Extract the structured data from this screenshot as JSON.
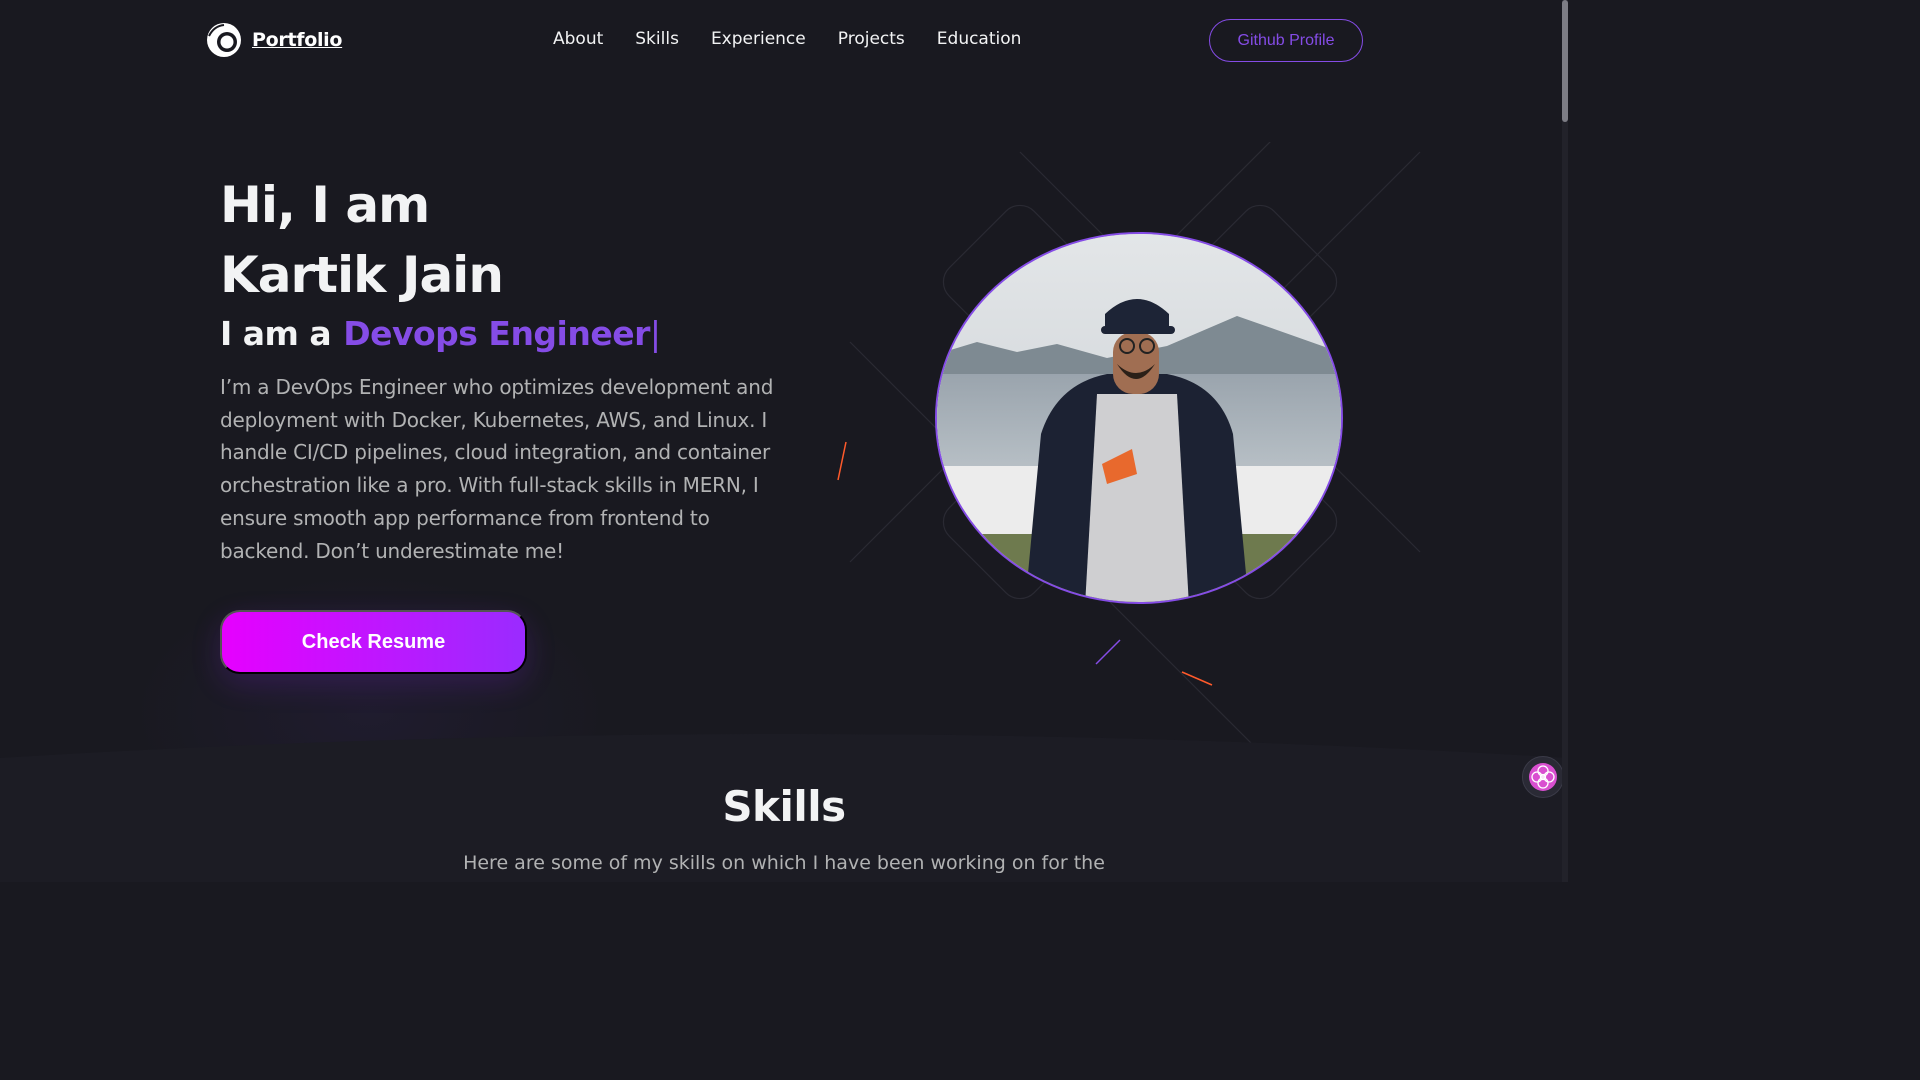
{
  "nav": {
    "logo_text": "Portfolio",
    "links": [
      "About",
      "Skills",
      "Experience",
      "Projects",
      "Education"
    ],
    "github_label": "Github Profile"
  },
  "hero": {
    "greeting_line1": "Hi, I am",
    "greeting_line2": "Kartik Jain",
    "subtitle_prefix": "I am a",
    "role": "Devops Engineer",
    "cursor": "|",
    "description": "I’m a DevOps Engineer who optimizes development and deployment with Docker, Kubernetes, AWS, and Linux. I handle CI/CD pipelines, cloud integration, and container orchestration like a pro. With full-stack skills in MERN, I ensure smooth app performance from frontend to backend. Don’t underestimate me!",
    "resume_button": "Check Resume",
    "photo_icon": "profile-photo"
  },
  "skills": {
    "title": "Skills",
    "description": "Here are some of my skills on which I have been working on for the"
  },
  "colors": {
    "background": "#191920",
    "accent": "#854ce6",
    "text_primary": "#f2f3f4",
    "text_secondary": "#b1b2b3",
    "button_gradient_start": "#e600ff",
    "button_gradient_end": "#9a2bff"
  },
  "widget": {
    "icon": "flower-icon"
  }
}
